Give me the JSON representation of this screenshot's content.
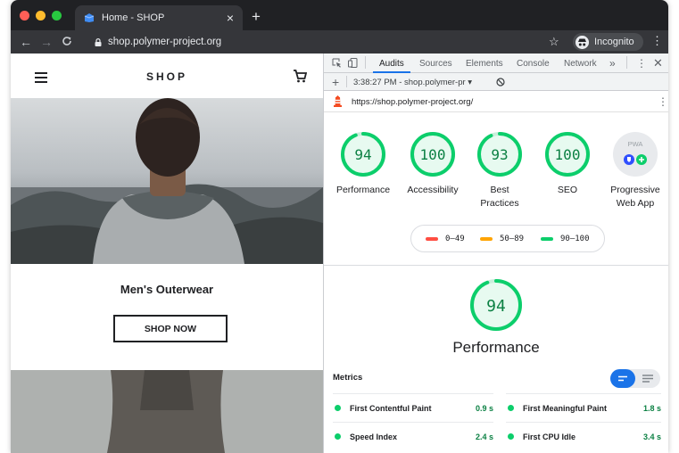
{
  "browser": {
    "tab_title": "Home - SHOP",
    "tab_close": "×",
    "new_tab": "+",
    "url": "shop.polymer-project.org",
    "incognito_label": "Incognito",
    "colors": {
      "frame": "#202124",
      "toolbar": "#35363a",
      "close": "#ff5f57",
      "minimize": "#febc2e",
      "zoom": "#28c840"
    }
  },
  "shop": {
    "logo": "SHOP",
    "hero_title": "Men's Outerwear",
    "shop_now": "SHOP NOW"
  },
  "devtools": {
    "tabs": [
      "Audits",
      "Sources",
      "Elements",
      "Console",
      "Network"
    ],
    "more": "»",
    "active_tab": "Audits",
    "report_selector": "3:38:27 PM - shop.polymer-pr ▾",
    "audited_url": "https://shop.polymer-project.org/",
    "categories": [
      {
        "score": "94",
        "value": 94,
        "label": "Performance"
      },
      {
        "score": "100",
        "value": 100,
        "label": "Accessibility"
      },
      {
        "score": "93",
        "value": 93,
        "label": "Best Practices"
      },
      {
        "score": "100",
        "value": 100,
        "label": "SEO"
      },
      {
        "score": "",
        "label": "Progressive Web App",
        "badge": "PWA"
      }
    ],
    "legend": [
      {
        "range": "0–49",
        "color": "#ff4e42"
      },
      {
        "range": "50–89",
        "color": "#ffa400"
      },
      {
        "range": "90–100",
        "color": "#0cce6b"
      }
    ],
    "performance": {
      "score": "94",
      "value": 94,
      "title": "Performance",
      "metrics_label": "Metrics",
      "metrics": [
        {
          "label": "First Contentful Paint",
          "value": "0.9 s"
        },
        {
          "label": "First Meaningful Paint",
          "value": "1.8 s"
        },
        {
          "label": "Speed Index",
          "value": "2.4 s"
        },
        {
          "label": "First CPU Idle",
          "value": "3.4 s"
        }
      ]
    },
    "pass_color": "#0cce6b"
  }
}
